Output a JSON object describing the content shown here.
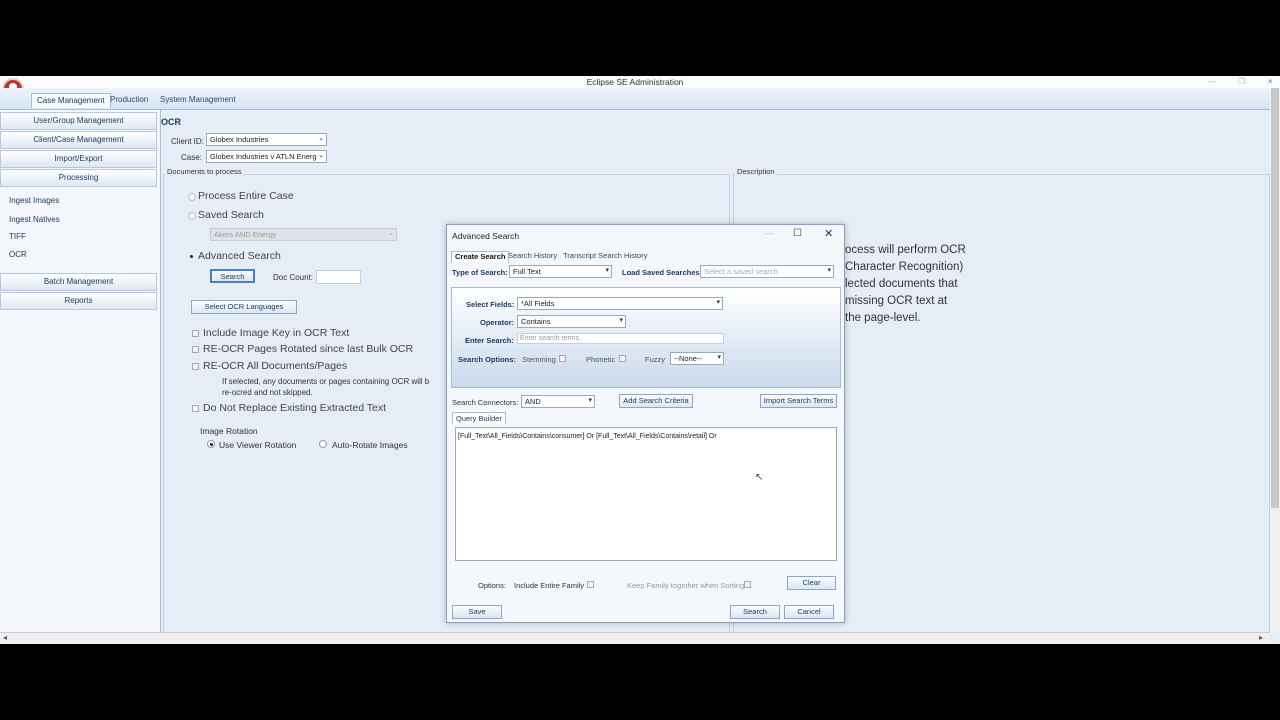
{
  "window": {
    "title": "Eclipse SE Administration"
  },
  "top_tabs": [
    {
      "label": "Case Management",
      "active": true
    },
    {
      "label": "Production",
      "active": false
    },
    {
      "label": "System Management",
      "active": false
    }
  ],
  "sidebar": {
    "buttons": [
      "User/Group Management",
      "Client/Case Management",
      "Import/Export",
      "Processing"
    ],
    "sub_items": [
      "Ingest Images",
      "Ingest Natives",
      "TIFF",
      "OCR"
    ],
    "buttons2": [
      "Batch Management",
      "Reports"
    ]
  },
  "main": {
    "heading": "OCR",
    "client_label": "Client ID:",
    "client_value": "Globex Industries",
    "case_label": "Case:",
    "case_value": "Globex Industries v ATLN Energ",
    "docs_group": "Documents to process",
    "description_group": "Description",
    "process_entire": "Process Entire Case",
    "saved_search": "Saved Search",
    "saved_search_value": "Akers AND Energy",
    "advanced_search": "Advanced Search",
    "search_button": "Search",
    "doc_count_label": "Doc Count:",
    "doc_count_value": "",
    "ocr_languages_button": "Select OCR Languages",
    "include_image_key": "Include Image Key in OCR Text",
    "reocr_rotated": "RE-OCR Pages Rotated since last Bulk OCR",
    "reocr_all": "RE-OCR All Documents/Pages",
    "reocr_note_1": "If selected, any documents or pages containing OCR will b",
    "reocr_note_2": "re-ocred and not skipped.",
    "do_not_replace": "Do Not Replace Existing Extracted Text",
    "image_rotation": "Image Rotation",
    "use_viewer_rotation": "Use Viewer Rotation",
    "auto_rotate": "Auto-Rotate Images",
    "description_lines": [
      "ocess will perform OCR",
      "Character Recognition)",
      "lected documents that",
      "missing OCR text at",
      "the page-level."
    ]
  },
  "dialog": {
    "title": "Advanced Search",
    "tabs": [
      "Create Search",
      "Search History",
      "Transcript Search History"
    ],
    "type_of_search_label": "Type of Search:",
    "type_of_search_value": "Full Text",
    "load_saved_label": "Load Saved Searches",
    "load_saved_placeholder": "Select a saved search",
    "select_fields_label": "Select Fields:",
    "select_fields_value": "*All Fields",
    "operator_label": "Operator:",
    "operator_value": "Contains",
    "enter_search_label": "Enter Search:",
    "enter_search_placeholder": "Enter search terms",
    "search_options_label": "Search Options:",
    "stemming": "Stemming",
    "phonetic": "Phonetic",
    "fuzzy": "Fuzzy",
    "fuzzy_value": "--None--",
    "connectors_label": "Search Connectors:",
    "connectors_value": "AND",
    "add_criteria": "Add Search Criteria",
    "import_terms": "Import Search Terms",
    "query_builder_tab": "Query Builder",
    "query_text": "[Full_Text\\All_Fields\\Contains\\consumer] Or  [Full_Text\\All_Fields\\Contains\\retail] Or",
    "options_label": "Options:",
    "include_family": "Include Entire Family",
    "keep_family": "Keep Family together when Sorting",
    "clear": "Clear",
    "save": "Save",
    "search": "Search",
    "cancel": "Cancel"
  },
  "colors": {
    "accent": "#1f3b60",
    "panel": "#e6edf7",
    "logo": "#b23a2e"
  }
}
